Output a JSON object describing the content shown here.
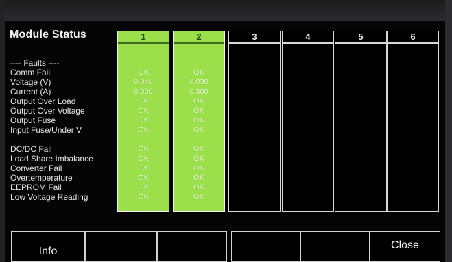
{
  "screen": {
    "title": "Module Status"
  },
  "labels": [
    "---- Faults ----",
    "Comm Fail",
    "Voltage (V)",
    "Current (A)",
    "Output Over Load",
    "Output Over Voltage",
    "Output Fuse",
    "Input Fuse/Under V",
    "DC/DC Fail",
    "Load Share Imbalance",
    "Converter Fail",
    "Overtemperature",
    "EEPROM Fail",
    "Low Voltage Reading"
  ],
  "modules": [
    {
      "number": "1",
      "active": true,
      "values": [
        "OK",
        "0.040",
        "0.000",
        "OK",
        "OK",
        "OK",
        "OK",
        "OK",
        "OK",
        "OK",
        "OK",
        "OK",
        "OK"
      ]
    },
    {
      "number": "2",
      "active": true,
      "values": [
        "OK",
        "0.030",
        "0.300",
        "OK",
        "OK",
        "OK",
        "OK",
        "OK",
        "OK",
        "OK",
        "OK",
        "OK",
        "OK"
      ]
    },
    {
      "number": "3",
      "active": false,
      "values": []
    },
    {
      "number": "4",
      "active": false,
      "values": []
    },
    {
      "number": "5",
      "active": false,
      "values": []
    },
    {
      "number": "6",
      "active": false,
      "values": []
    }
  ],
  "softkeys": [
    "Info",
    "",
    "",
    "",
    "",
    "Close"
  ],
  "colors": {
    "active_column": "#9be04a",
    "background": "#050505",
    "text": "#eaffd8"
  }
}
